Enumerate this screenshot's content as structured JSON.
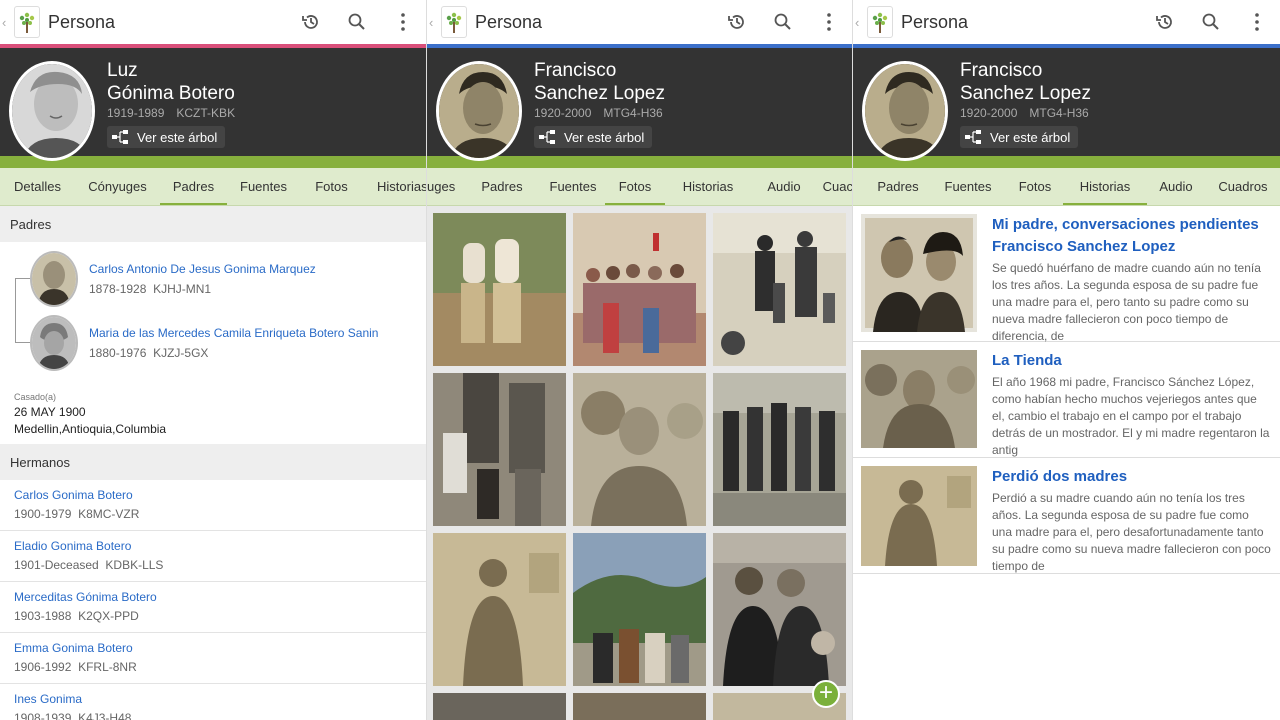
{
  "colors": {
    "accent_pink": "#d94f7a",
    "accent_blue": "#3b6fc9",
    "green": "#87b03d",
    "tabbar": "#dfebcd",
    "header_dark": "#333333",
    "link": "#2a6bc7"
  },
  "appbar": {
    "title": "Persona",
    "back_glyph": "‹"
  },
  "screen1": {
    "person": {
      "first": "Luz",
      "last": "Gónima Botero",
      "years": "1919-1989",
      "id": "KCZT-KBK",
      "tree_button": "Ver este árbol"
    },
    "tabs": [
      "Detalles",
      "Cónyuges",
      "Padres",
      "Fuentes",
      "Fotos",
      "Historias"
    ],
    "active_tab": "Padres",
    "parents_heading": "Padres",
    "parents": [
      {
        "name": "Carlos Antonio De Jesus Gonima Marquez",
        "years": "1878-1928",
        "id": "KJHJ-MN1"
      },
      {
        "name": "Maria de las Mercedes Camila Enriqueta Botero Sanin",
        "years": "1880-1976",
        "id": "KJZJ-5GX"
      }
    ],
    "married": {
      "label": "Casado(a)",
      "date": "26 MAY 1900",
      "place": "Medellin,Antioquia,Columbia"
    },
    "siblings_heading": "Hermanos",
    "siblings": [
      {
        "name": "Carlos Gonima Botero",
        "years": "1900-1979",
        "id": "K8MC-VZR"
      },
      {
        "name": "Eladio Gonima Botero",
        "years": "1901-Deceased",
        "id": "KDBK-LLS"
      },
      {
        "name": "Merceditas Gónima Botero",
        "years": "1903-1988",
        "id": "K2QX-PPD"
      },
      {
        "name": "Emma Gonima Botero",
        "years": "1906-1992",
        "id": "KFRL-8NR"
      },
      {
        "name": "Ines Gonima",
        "years": "1908-1939",
        "id": "K4J3-H48"
      }
    ]
  },
  "screen2": {
    "person": {
      "first": "Francisco",
      "last": "Sanchez Lopez",
      "years": "1920-2000",
      "id": "MTG4-H36",
      "tree_button": "Ver este árbol"
    },
    "tabs": [
      "uges",
      "Padres",
      "Fuentes",
      "Fotos",
      "Historias",
      "Audio",
      "Cuac"
    ],
    "active_tab": "Fotos",
    "fab_glyph": "+"
  },
  "screen3": {
    "person": {
      "first": "Francisco",
      "last": "Sanchez Lopez",
      "years": "1920-2000",
      "id": "MTG4-H36",
      "tree_button": "Ver este árbol"
    },
    "tabs": [
      "Padres",
      "Fuentes",
      "Fotos",
      "Historias",
      "Audio",
      "Cuadros"
    ],
    "active_tab": "Historias",
    "stories": [
      {
        "title": "Mi padre, conversaciones pendientes Francisco Sanchez Lopez",
        "text": "Se quedó huérfano de madre cuando aún no tenía los tres años. La segunda esposa de su padre fue una madre para el, pero tanto su padre como su nueva madre fallecieron con poco tiempo de diferencia, de"
      },
      {
        "title": "La Tienda",
        "text": "El año 1968 mi padre, Francisco Sánchez López, como habían hecho muchos vejeriegos antes que el, cambio el trabajo en el campo por el trabajo detrás de un mostrador. El y mi madre regentaron la antig"
      },
      {
        "title": "Perdió dos madres",
        "text": "Perdió a su madre cuando aún no tenía los tres años. La segunda esposa de su padre fue como una madre para el, pero desafortunadamente tanto su padre como su nueva madre fallecieron con poco tiempo de"
      }
    ]
  }
}
